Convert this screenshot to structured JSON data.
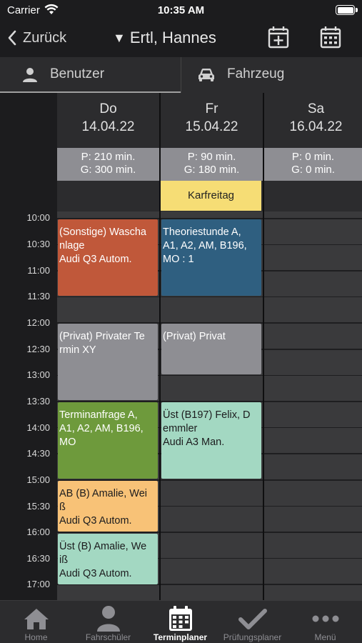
{
  "status_bar": {
    "carrier": "Carrier",
    "time": "10:35 AM"
  },
  "nav": {
    "back_label": "Zurück",
    "user": "Ertl, Hannes"
  },
  "segments": {
    "user_label": "Benutzer",
    "vehicle_label": "Fahrzeug"
  },
  "days": [
    {
      "weekday": "Do",
      "date": "14.04.22",
      "p": "P: 210 min.",
      "g": "G: 300 min."
    },
    {
      "weekday": "Fr",
      "date": "15.04.22",
      "p": "P: 90 min.",
      "g": "G: 180 min."
    },
    {
      "weekday": "Sa",
      "date": "16.04.22",
      "p": "P: 0 min.",
      "g": "G: 0 min."
    }
  ],
  "holiday": "Karfreitag",
  "times": [
    "10:00",
    "10:30",
    "11:00",
    "11:30",
    "12:00",
    "12:30",
    "13:00",
    "13:30",
    "14:00",
    "14:30",
    "15:00",
    "15:30",
    "16:00",
    "16:30",
    "17:00"
  ],
  "events": [
    {
      "lines": [
        "(Sonstige) Wascha",
        "nlage",
        "Audi Q3 Autom."
      ],
      "color": "#c0583a"
    },
    {
      "lines": [
        "Theoriestunde A,",
        "A1, A2, AM, B196,",
        "MO : 1"
      ],
      "color": "#2f5f80"
    },
    {
      "lines": [
        "(Privat) Privater Te",
        "rmin XY"
      ],
      "color": "#8e8e93"
    },
    {
      "lines": [
        "(Privat) Privat"
      ],
      "color": "#8e8e93"
    },
    {
      "lines": [
        "Terminanfrage A,",
        "A1, A2, AM, B196,",
        "MO"
      ],
      "color": "#6e9a3c"
    },
    {
      "lines": [
        "Üst (B197) Felix, D",
        "emmler",
        "Audi A3 Man."
      ],
      "color": "#a3d8c2"
    },
    {
      "lines": [
        "AB (B) Amalie, Wei",
        "ß",
        "Audi Q3 Autom."
      ],
      "color": "#f8c277"
    },
    {
      "lines": [
        "Üst (B) Amalie, We",
        "iß",
        "Audi Q3 Autom."
      ],
      "color": "#a3d8c2"
    }
  ],
  "tabs": [
    {
      "label": "Home",
      "icon": "home-icon"
    },
    {
      "label": "Fahrschüler",
      "icon": "person-icon"
    },
    {
      "label": "Terminplaner",
      "icon": "calendar-icon"
    },
    {
      "label": "Prüfungsplaner",
      "icon": "checkmark-icon"
    },
    {
      "label": "Menü",
      "icon": "more-icon"
    }
  ],
  "active_tab": "Terminplaner"
}
